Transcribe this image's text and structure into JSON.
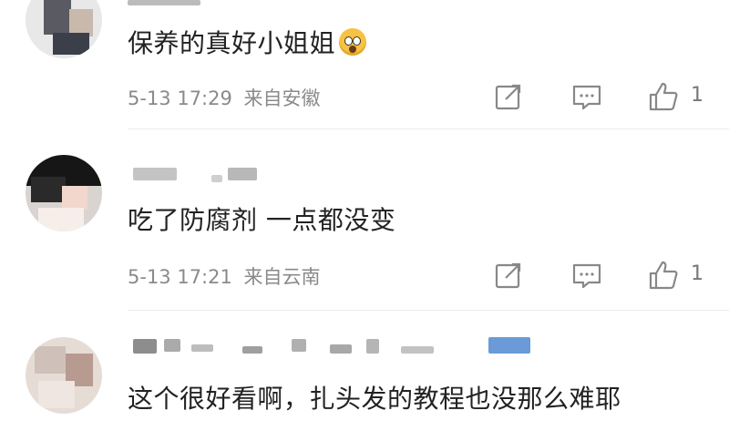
{
  "comments": [
    {
      "text": "保养的真好小姐姐",
      "emoji": "scream-emoji",
      "time": "5-13 17:29",
      "location": "来自安徽",
      "like_count": "1"
    },
    {
      "text": "吃了防腐剂 一点都没变",
      "time": "5-13 17:21",
      "location": "来自云南",
      "like_count": "1"
    },
    {
      "text": "这个很好看啊，扎头发的教程也没那么难耶"
    }
  ],
  "colors": {
    "text": "#222222",
    "meta": "#8a8a8a",
    "icon": "#888888",
    "divider": "#ececec"
  }
}
